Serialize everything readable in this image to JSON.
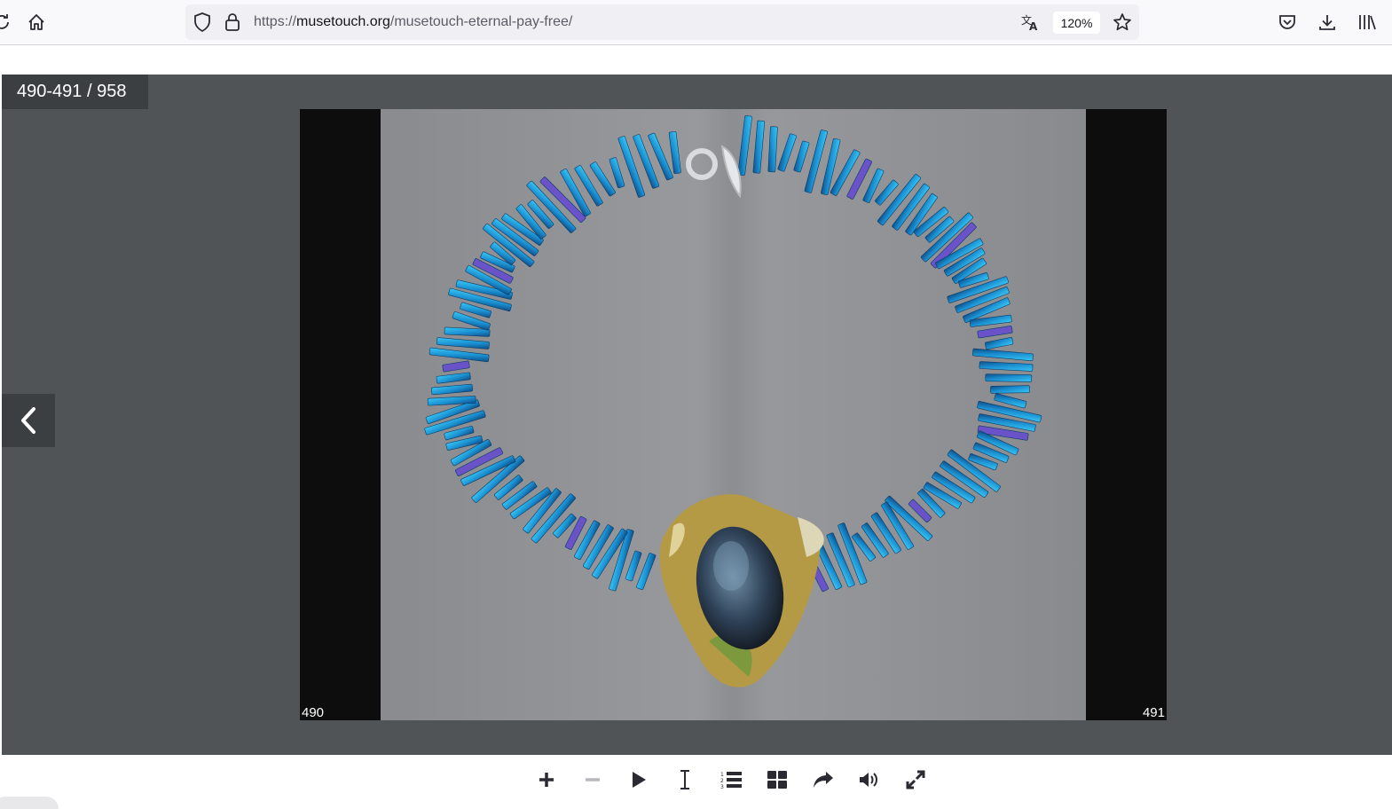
{
  "browser": {
    "url_prefix": "https://",
    "url_host": "musetouch.org",
    "url_path": "/musetouch-eternal-pay-free/",
    "zoom": "120%",
    "icons": [
      "reload-icon",
      "home-icon",
      "shield-icon",
      "lock-icon",
      "translate-icon",
      "bookmark-star-icon",
      "pocket-icon",
      "download-icon",
      "library-icon"
    ]
  },
  "viewer": {
    "page_counter": "490-491 / 958",
    "left_page_number": "490",
    "right_page_number": "491",
    "photo_description_icon": "necklace-photo"
  },
  "controls": {
    "buttons": [
      {
        "name": "zoom-in",
        "icon": "plus-icon",
        "enabled": true
      },
      {
        "name": "zoom-out",
        "icon": "minus-icon",
        "enabled": false
      },
      {
        "name": "autoplay",
        "icon": "play-icon",
        "enabled": true
      },
      {
        "name": "text-select",
        "icon": "text-cursor-icon",
        "enabled": true
      },
      {
        "name": "table-of-contents",
        "icon": "numbered-list-icon",
        "enabled": true
      },
      {
        "name": "thumbnails",
        "icon": "grid-icon",
        "enabled": true
      },
      {
        "name": "share",
        "icon": "share-arrow-icon",
        "enabled": true
      },
      {
        "name": "sound",
        "icon": "speaker-icon",
        "enabled": true
      },
      {
        "name": "fullscreen",
        "icon": "expand-icon",
        "enabled": true
      }
    ]
  },
  "colors": {
    "viewer_bg": "#505457",
    "overlay_dark": "#3c3f42",
    "bead_blue": "#1d9bd6"
  }
}
